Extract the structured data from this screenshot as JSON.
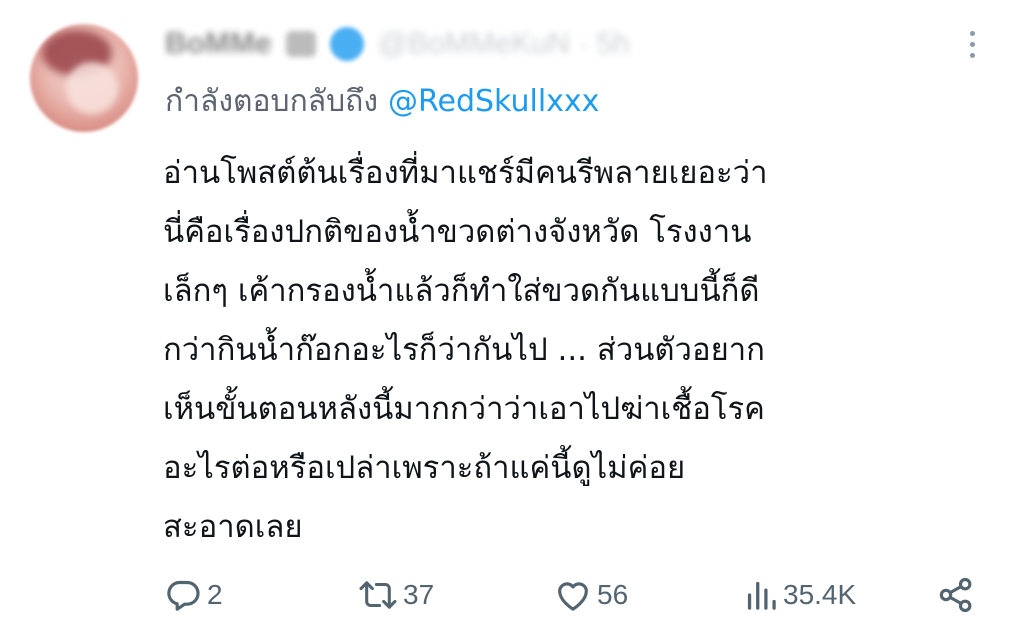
{
  "author": {
    "display_name": "BoMMe",
    "handle_time": "@BoMMeKuN · 5h"
  },
  "replying_to": {
    "prefix": "กำลังตอบกลับถึง",
    "mention": "@RedSkullxxx"
  },
  "body_lines": [
    "อ่านโพสต์ต้นเรื่องที่มาแชร์มีคนรีพลายเยอะว่า",
    "นี่คือเรื่องปกติของน้ำขวดต่างจังหวัด โรงงาน",
    "เล็กๆ เค้ากรองน้ำแล้วก็ทำใส่ขวดกันแบบนี้ก็ดี",
    "กว่ากินน้ำก๊อกอะไรก็ว่ากันไป ... ส่วนตัวอยาก",
    "เห็นขั้นตอนหลังนี้มากกว่าว่าเอาไปฆ่าเชื้อโรค",
    "อะไรต่อหรือเปล่าเพราะถ้าแค่นี้ดูไม่ค่อย",
    "สะอาดเลย"
  ],
  "actions": {
    "replies": "2",
    "retweets": "37",
    "likes": "56",
    "views": "35.4K"
  },
  "icons": {
    "reply": "reply-icon",
    "retweet": "retweet-icon",
    "like": "heart-icon",
    "views": "views-icon",
    "share": "share-icon",
    "more": "more-icon",
    "verified": "verified-badge-icon"
  },
  "colors": {
    "accent": "#1d9bf0",
    "text": "#0f1419",
    "muted": "#536471"
  }
}
